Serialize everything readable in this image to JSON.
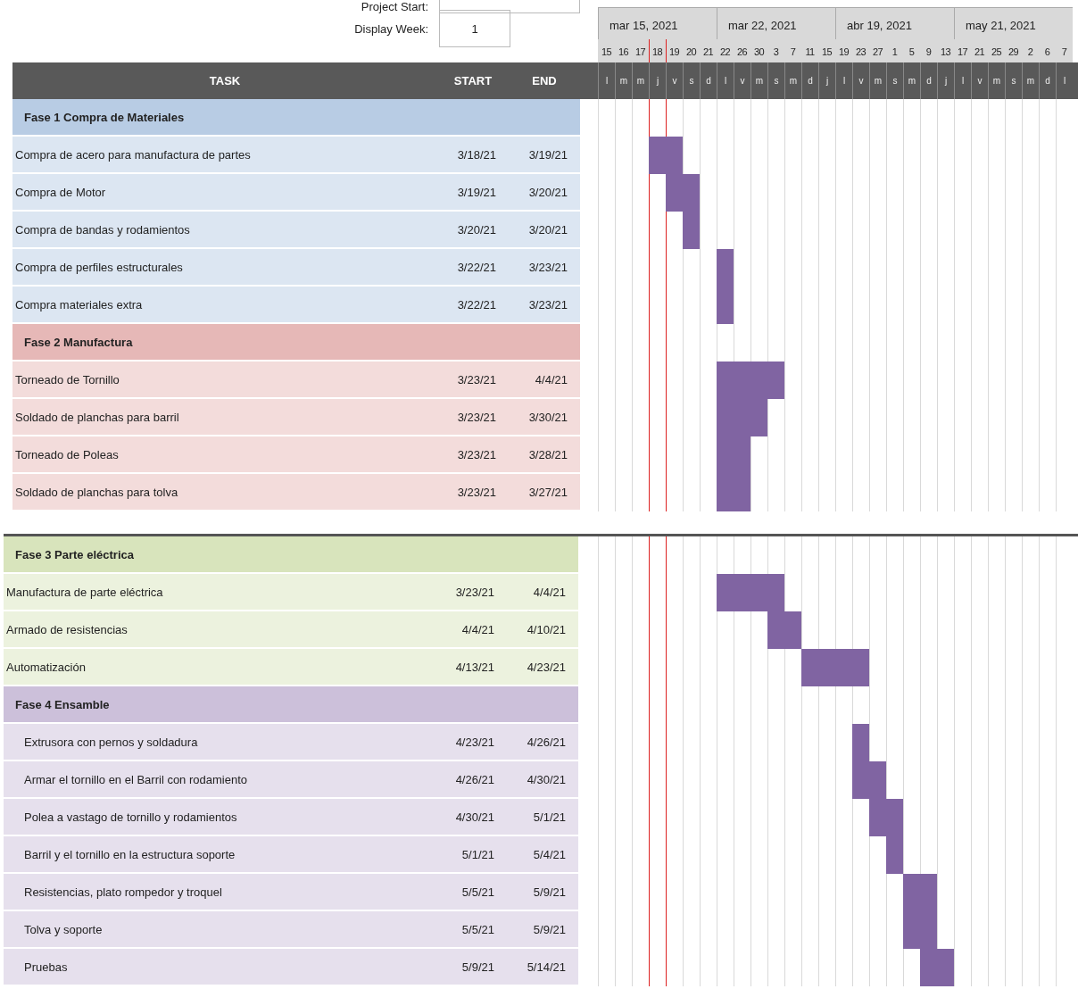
{
  "project_start": {
    "label": "Project Start:"
  },
  "display_week": {
    "label": "Display Week:",
    "value": "1"
  },
  "table": {
    "columns": [
      "TASK",
      "START",
      "END"
    ]
  },
  "timeline": {
    "weeks": [
      {
        "label": "mar 15, 2021",
        "days": [
          {
            "number": "15",
            "weekday": "l"
          },
          {
            "number": "16",
            "weekday": "m"
          },
          {
            "number": "17",
            "weekday": "m"
          },
          {
            "number": "18",
            "weekday": "j"
          },
          {
            "number": "19",
            "weekday": "v"
          },
          {
            "number": "20",
            "weekday": "s"
          },
          {
            "number": "21",
            "weekday": "d"
          }
        ]
      },
      {
        "label": "mar 22, 2021",
        "days": [
          {
            "number": "22",
            "weekday": "l"
          },
          {
            "number": "26",
            "weekday": "v"
          },
          {
            "number": "30",
            "weekday": "m"
          },
          {
            "number": "3",
            "weekday": "s"
          },
          {
            "number": "7",
            "weekday": "m"
          },
          {
            "number": "11",
            "weekday": "d"
          },
          {
            "number": "15",
            "weekday": "j"
          }
        ]
      },
      {
        "label": "abr 19, 2021",
        "days": [
          {
            "number": "19",
            "weekday": "l"
          },
          {
            "number": "23",
            "weekday": "v"
          },
          {
            "number": "27",
            "weekday": "m"
          },
          {
            "number": "1",
            "weekday": "s"
          },
          {
            "number": "5",
            "weekday": "m"
          },
          {
            "number": "9",
            "weekday": "d"
          },
          {
            "number": "13",
            "weekday": "j"
          }
        ]
      },
      {
        "label": "may 21, 2021",
        "days": [
          {
            "number": "17",
            "weekday": "l"
          },
          {
            "number": "21",
            "weekday": "v"
          },
          {
            "number": "25",
            "weekday": "m"
          },
          {
            "number": "29",
            "weekday": "s"
          },
          {
            "number": "2",
            "weekday": "m"
          },
          {
            "number": "6",
            "weekday": "d"
          },
          {
            "number": "7",
            "weekday": "l"
          }
        ]
      }
    ]
  },
  "sections": [
    {
      "phases": [
        {
          "title": "Fase 1 Compra de Materiales",
          "color": "#b8cce4",
          "indent_tasks": false,
          "tasks": [
            {
              "name": "Compra de acero para manufactura de partes",
              "start": "3/18/21",
              "end": "3/19/21"
            },
            {
              "name": "Compra de Motor",
              "start": "3/19/21",
              "end": "3/20/21"
            },
            {
              "name": "Compra de bandas y rodamientos",
              "start": "3/20/21",
              "end": "3/20/21"
            },
            {
              "name": "Compra de perfiles estructurales",
              "start": "3/22/21",
              "end": "3/23/21"
            },
            {
              "name": "Compra materiales extra",
              "start": "3/22/21",
              "end": "3/23/21"
            }
          ]
        },
        {
          "title": "Fase 2 Manufactura",
          "color": "#e6b8b7",
          "indent_tasks": false,
          "tasks": [
            {
              "name": "Torneado de Tornillo",
              "start": "3/23/21",
              "end": "4/4/21"
            },
            {
              "name": "Soldado de planchas para barril",
              "start": "3/23/21",
              "end": "3/30/21"
            },
            {
              "name": "Torneado de Poleas",
              "start": "3/23/21",
              "end": "3/28/21"
            },
            {
              "name": "Soldado de planchas para tolva",
              "start": "3/23/21",
              "end": "3/27/21"
            }
          ]
        }
      ]
    },
    {
      "phases": [
        {
          "title": "Fase 3 Parte eléctrica",
          "color": "#d8e4bc",
          "indent_tasks": false,
          "tasks": [
            {
              "name": "Manufactura de parte eléctrica",
              "start": "3/23/21",
              "end": "4/4/21"
            },
            {
              "name": "Armado de resistencias",
              "start": "4/4/21",
              "end": "4/10/21"
            },
            {
              "name": "Automatización",
              "start": "4/13/21",
              "end": "4/23/21"
            }
          ]
        },
        {
          "title": "Fase 4 Ensamble",
          "color": "#ccc0da",
          "indent_tasks": true,
          "tasks": [
            {
              "name": "Extrusora con pernos y soldadura",
              "start": "4/23/21",
              "end": "4/26/21"
            },
            {
              "name": "Armar el tornillo en el Barril con rodamiento",
              "start": "4/26/21",
              "end": "4/30/21"
            },
            {
              "name": "Polea a vastago de tornillo y rodamientos",
              "start": "4/30/21",
              "end": "5/1/21"
            },
            {
              "name": "Barril y el tornillo en la estructura soporte",
              "start": "5/1/21",
              "end": "5/4/21"
            },
            {
              "name": "Resistencias, plato rompedor y troquel",
              "start": "5/5/21",
              "end": "5/9/21"
            },
            {
              "name": "Tolva y soporte",
              "start": "5/5/21",
              "end": "5/9/21"
            },
            {
              "name": "Pruebas",
              "start": "5/9/21",
              "end": "5/14/21"
            }
          ]
        }
      ]
    }
  ]
}
